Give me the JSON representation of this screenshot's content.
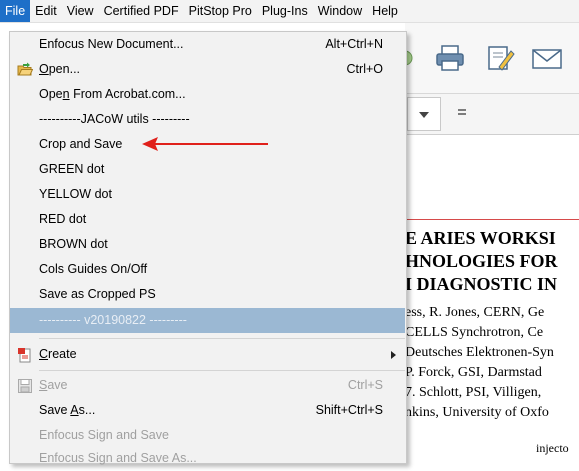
{
  "menubar": {
    "items": [
      "File",
      "Edit",
      "View",
      "Certified PDF",
      "PitStop Pro",
      "Plug-Ins",
      "Window",
      "Help"
    ]
  },
  "file_menu": {
    "new_doc": {
      "label": "Enfocus New Document...",
      "shortcut": "Alt+Ctrl+N"
    },
    "open": {
      "label_pre": "",
      "label_u": "O",
      "label_post": "pen...",
      "shortcut": "Ctrl+O"
    },
    "open_acrobat": {
      "label_pre": "Ope",
      "label_u": "n",
      "label_post": " From Acrobat.com..."
    },
    "jacow_header": "----------JACoW utils ---------",
    "crop_save": "Crop and Save",
    "green_dot": "GREEN dot",
    "yellow_dot": "YELLOW dot",
    "red_dot": "RED dot",
    "brown_dot": "BROWN dot",
    "cols_guides": "Cols Guides On/Off",
    "save_cropped_ps": "Save as Cropped PS",
    "version": "---------- v20190822 ---------",
    "create": {
      "label_u": "C",
      "label_post": "reate"
    },
    "save": {
      "label_u": "S",
      "label_post": "ave",
      "shortcut": "Ctrl+S"
    },
    "save_as": {
      "label_pre": "Save ",
      "label_u": "A",
      "label_post": "s...",
      "shortcut": "Shift+Ctrl+S"
    },
    "enfocus_sign": "Enfocus Sign and Save",
    "enfocus_sign_as": "Enfocus Sign and Save As..."
  },
  "document": {
    "title_lines": [
      "E ARIES WORKSI",
      "HNOLOGIES FOR",
      "I DIAGNOSTIC IN"
    ],
    "author_lines": [
      "ess, R. Jones, CERN, Ge",
      "CELLS Synchrotron, Ce",
      "Deutsches Elektronen-Syn",
      "P. Forck, GSI, Darmstad",
      "7. Schlott, PSI, Villigen,",
      "nkins, University of Oxfo"
    ],
    "body_fragment": "injecto"
  },
  "colors": {
    "accent": "#1e6fc8",
    "highlight": "#9bb8d3",
    "arrow": "#e0201b",
    "rule": "#d64a4a"
  },
  "icons": [
    "open-folder-icon",
    "create-pdf-icon",
    "save-disk-icon",
    "print-icon",
    "edit-icon",
    "mail-icon",
    "chevron-down-icon",
    "submenu-arrow-icon"
  ]
}
